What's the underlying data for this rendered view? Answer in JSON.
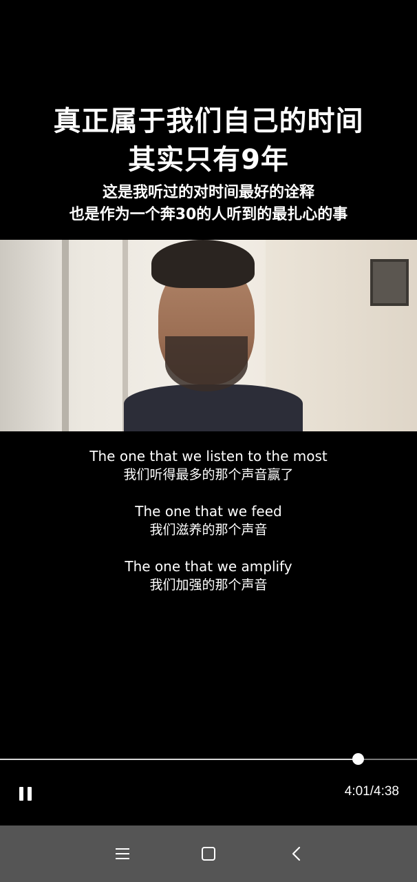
{
  "overlay": {
    "title_lines": [
      "真正属于我们自己的时间",
      "其实只有9年"
    ],
    "subtitle_lines": [
      "这是我听过的对时间最好的诠释",
      "也是作为一个奔30的人听到的最扎心的事"
    ]
  },
  "captions": [
    {
      "en": "The one that we listen to the most",
      "zh": "我们听得最多的那个声音赢了"
    },
    {
      "en": "The one that we feed",
      "zh": "我们滋养的那个声音"
    },
    {
      "en": "The one that we amplify",
      "zh": "我们加强的那个声音"
    }
  ],
  "player": {
    "time_display": "4:01/4:38",
    "progress_fraction": 0.858,
    "pause_icon": "pause-icon"
  },
  "nav_bar": {
    "icons": [
      "menu-icon",
      "home-icon",
      "back-icon"
    ]
  },
  "colors": {
    "background": "#000000",
    "nav_bar": "#555555",
    "text": "#ffffff"
  }
}
